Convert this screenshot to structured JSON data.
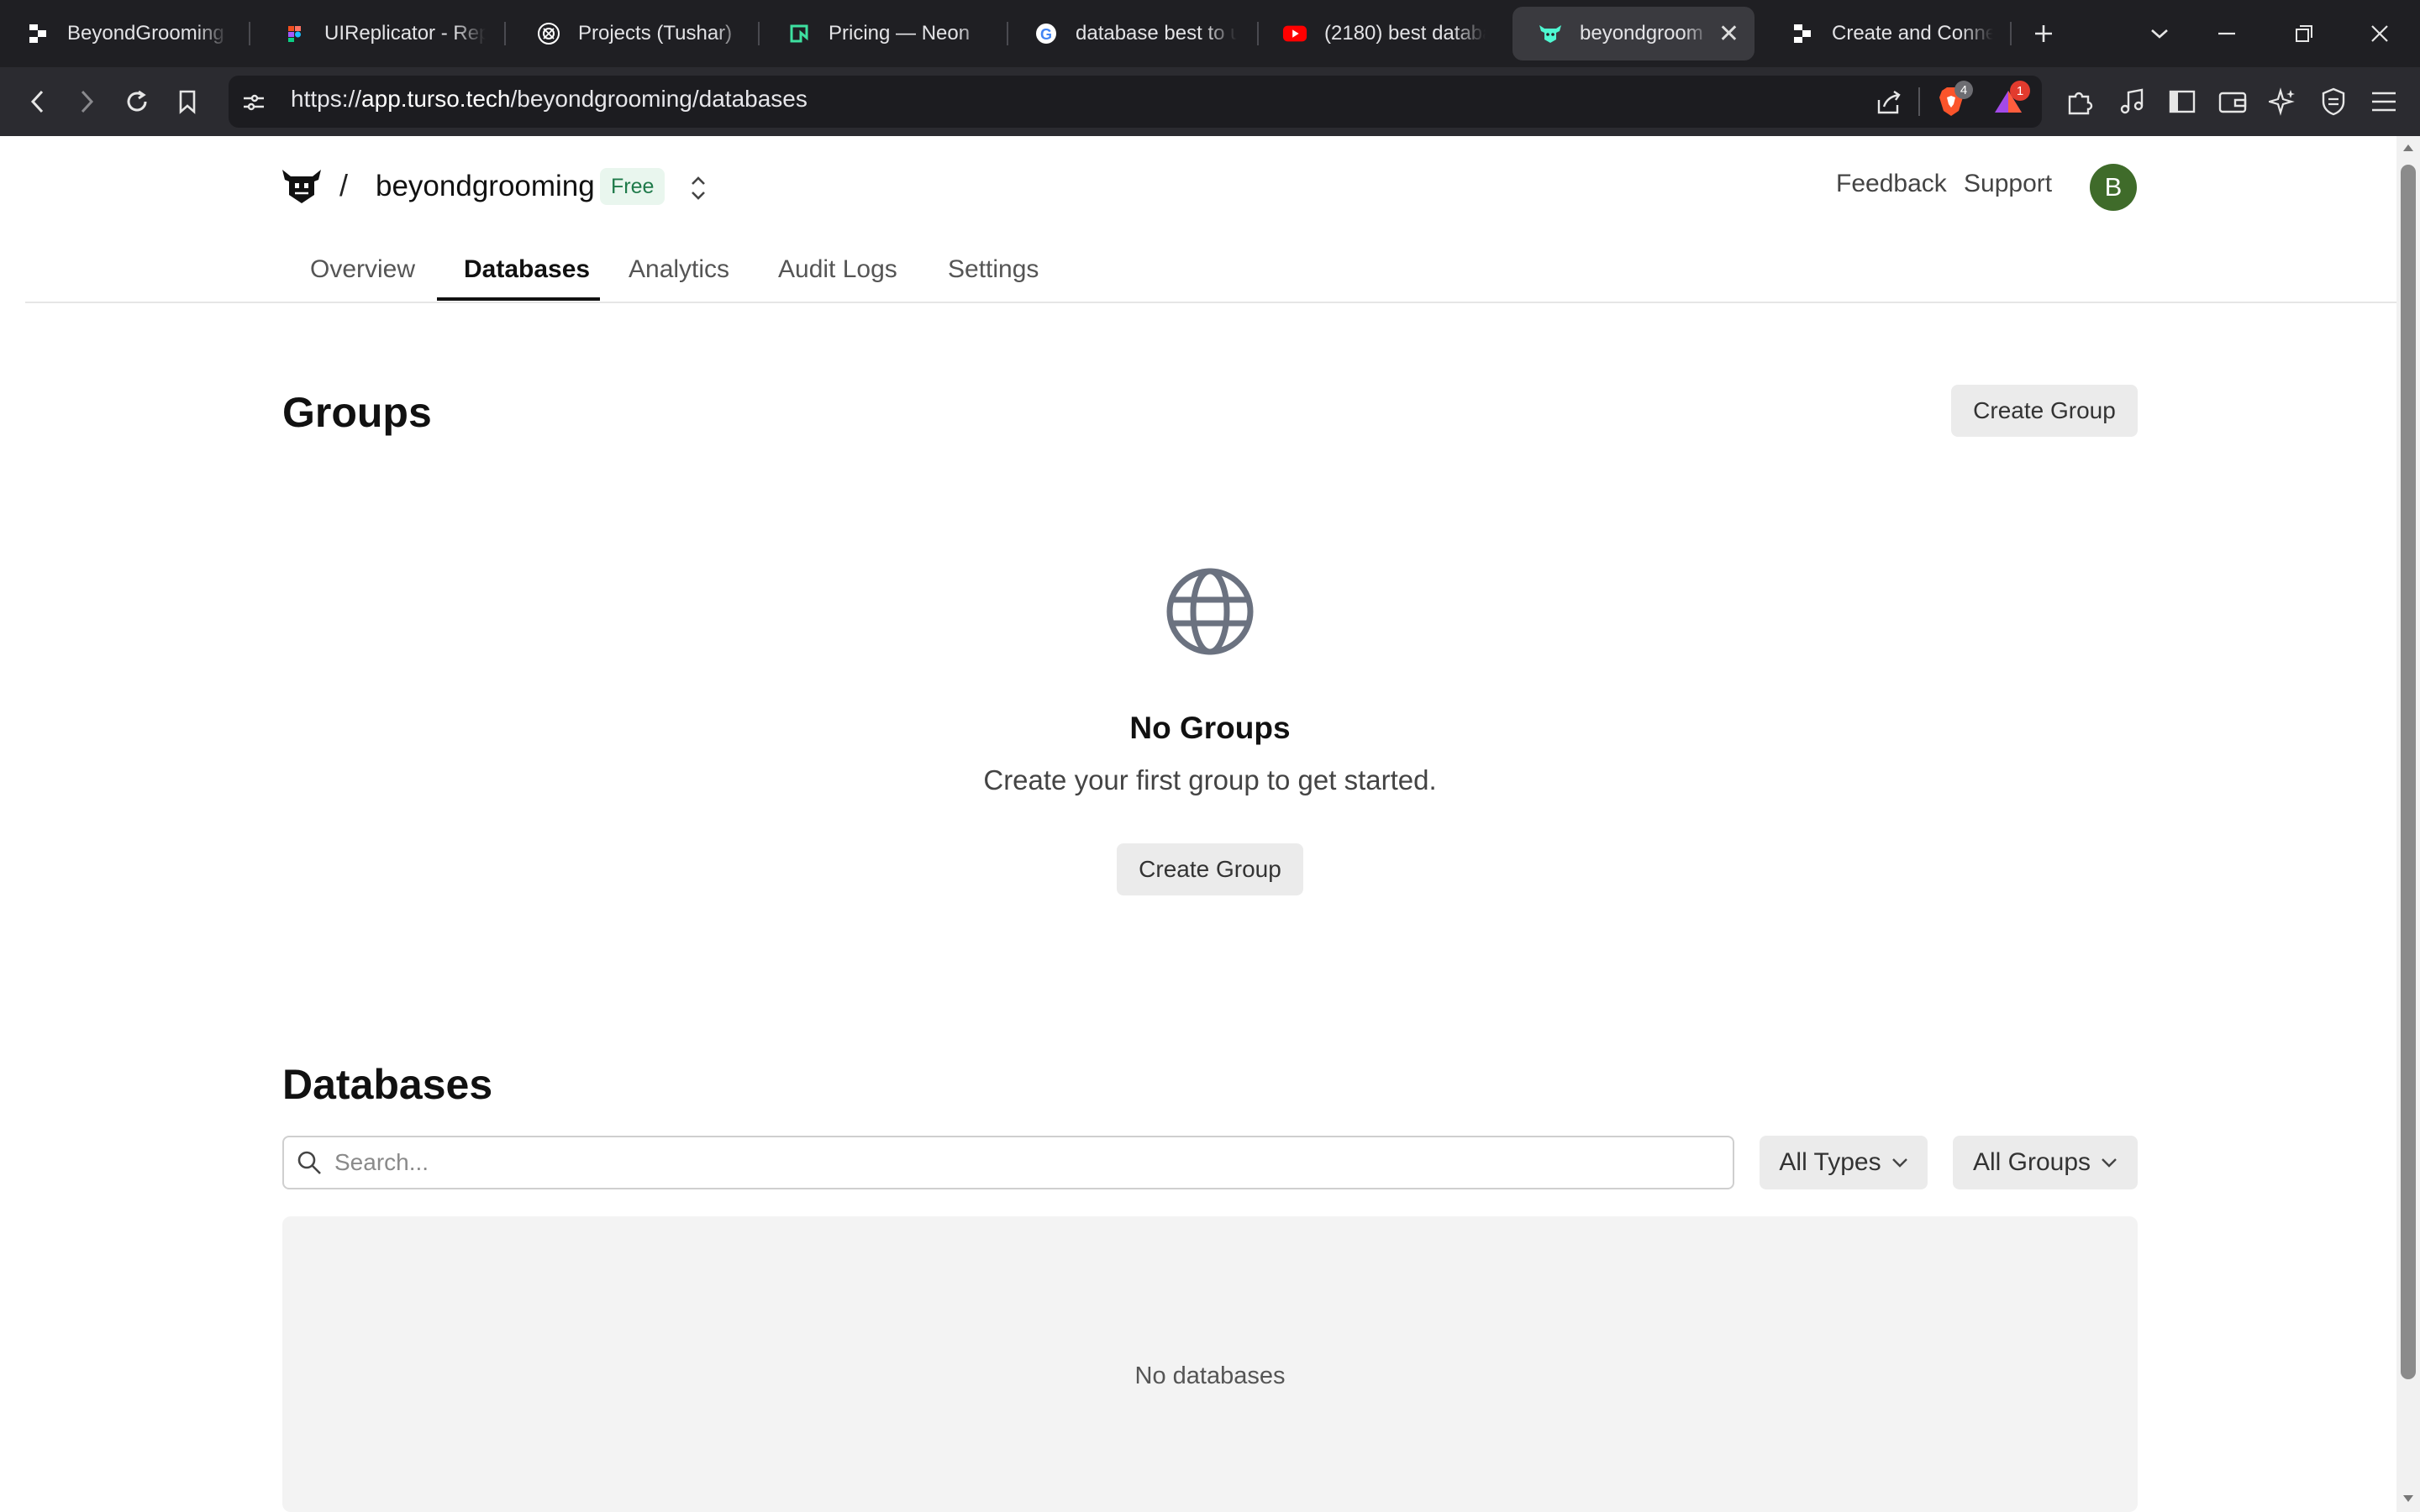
{
  "browser": {
    "tabs": [
      {
        "title": "BeyondGrooming -",
        "icon": "replit-icon"
      },
      {
        "title": "UIReplicator - Repl",
        "icon": "figma-icon"
      },
      {
        "title": "Projects (Tushar)",
        "icon": "openai-icon"
      },
      {
        "title": "Pricing — Neon",
        "icon": "neon-icon"
      },
      {
        "title": "database best to u",
        "icon": "google-icon"
      },
      {
        "title": "(2180) best databa",
        "icon": "youtube-icon"
      },
      {
        "title": "beyondgroom",
        "icon": "turso-icon",
        "active": true
      },
      {
        "title": "Create and Connec",
        "icon": "replit-icon"
      }
    ],
    "url_prefix": "https://",
    "url_domain": "app.turso.tech",
    "url_path": "/beyondgrooming/databases",
    "brave_shield_count": "4",
    "rewards_count": "1"
  },
  "header": {
    "separator": "/",
    "org_name": "beyondgrooming",
    "plan_badge": "Free",
    "feedback_label": "Feedback",
    "support_label": "Support",
    "avatar_initial": "B"
  },
  "nav": {
    "tabs": [
      {
        "label": "Overview"
      },
      {
        "label": "Databases",
        "active": true
      },
      {
        "label": "Analytics"
      },
      {
        "label": "Audit Logs"
      },
      {
        "label": "Settings"
      }
    ]
  },
  "groups": {
    "heading": "Groups",
    "create_button": "Create Group",
    "empty_icon": "globe-icon",
    "empty_title": "No Groups",
    "empty_subtitle": "Create your first group to get started.",
    "empty_create_button": "Create Group"
  },
  "databases": {
    "heading": "Databases",
    "search_placeholder": "Search...",
    "type_filter": "All Types",
    "group_filter": "All Groups",
    "empty_text": "No databases"
  },
  "colors": {
    "accent": "#111111",
    "badge_bg": "#e9f6ee",
    "badge_text": "#1f7a4a",
    "avatar": "#3f6b2a",
    "icon_gray": "#6b7280"
  }
}
